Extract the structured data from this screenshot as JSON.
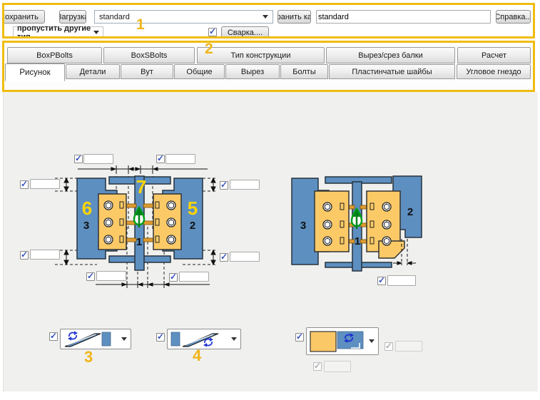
{
  "toolbar": {
    "save_label": "Сохранить",
    "load_label": "Загрузка",
    "profile_value": "standard",
    "save_as_label": "Сохранить как",
    "name_value": "standard",
    "help_label": "Справка...",
    "skip_type_label": "пропустить другие тип",
    "weld_label": "Сварка...."
  },
  "annotations": {
    "toolbar_num": "1",
    "tabs_num": "2",
    "combo1_num": "3",
    "combo2_num": "4"
  },
  "tabs_row1": [
    "BoxPBolts",
    "BoxSBolts",
    "Тип конструкции",
    "Вырез/срез балки",
    "Расчет"
  ],
  "tabs_row2": [
    "Рисунок",
    "Детали",
    "Вут",
    "Общие",
    "Вырез",
    "Болты",
    "Пластинчатые шайбы",
    "Угловое гнездо"
  ],
  "active_tab": "Рисунок",
  "diagram_left": {
    "n7": "7",
    "n6": "6",
    "n5": "5",
    "n3": "3",
    "n2": "2",
    "n1": "1"
  },
  "diagram_right": {
    "n3": "3",
    "n2": "2",
    "n1": "1"
  },
  "colors": {
    "accent_yellow": "#f0bc10",
    "annotation_yellow": "#f0b41b",
    "beam_blue": "#5d8fc1",
    "plate_orange": "#fbca67",
    "arrow_green": "#00a019",
    "check_blue": "#3450c0"
  }
}
